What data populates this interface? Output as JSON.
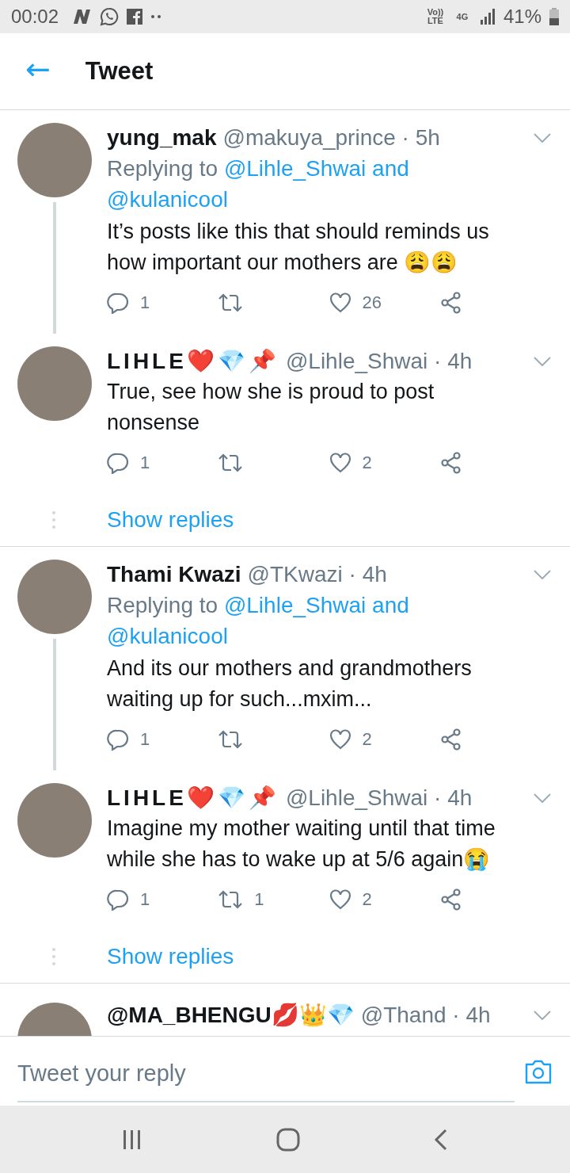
{
  "status_bar": {
    "time": "00:02",
    "network_label": "Vo)) LTE",
    "network_type": "4G",
    "battery": "41%"
  },
  "header": {
    "back": "←",
    "title": "Tweet"
  },
  "conversations": [
    {
      "tweets": [
        {
          "name": "yung_mak",
          "handle": "@makuya_prince · 5h",
          "replying_label": "Replying to",
          "replying_to": [
            "@Lihle_Shwai and",
            "@kulanicool"
          ],
          "text": "It’s posts like this that should reminds us how important our mothers are 😩😩",
          "replies": "1",
          "likes": "26",
          "thread_below": true,
          "spaced_name": false
        },
        {
          "name": "LIHLE❤️💎📌",
          "handle": "@Lihle_Shwai · 4h",
          "text": "True, see how she is proud to post nonsense",
          "replies": "1",
          "likes": "2",
          "thread_below": false,
          "spaced_name": true
        }
      ],
      "show_replies": "Show replies"
    },
    {
      "tweets": [
        {
          "name": "Thami Kwazi",
          "handle": "@TKwazi · 4h",
          "replying_label": "Replying to",
          "replying_to": [
            "@Lihle_Shwai and",
            "@kulanicool"
          ],
          "text": "And its our mothers and grandmothers waiting up for such...mxim...",
          "replies": "1",
          "likes": "2",
          "thread_below": true,
          "spaced_name": false
        },
        {
          "name": "LIHLE❤️💎📌",
          "handle": "@Lihle_Shwai · 4h",
          "text": "Imagine my mother waiting until that time while she has to wake up at 5/6 again😭",
          "replies": "1",
          "retweets": "1",
          "likes": "2",
          "thread_below": false,
          "spaced_name": true
        }
      ],
      "show_replies": "Show replies"
    },
    {
      "tweets": [
        {
          "name": "@MA_BHENGU💋👑💎",
          "handle": "@Thand · 4h",
          "thread_below": false,
          "spaced_name": false
        }
      ]
    }
  ],
  "reply_bar": {
    "placeholder": "Tweet your reply"
  }
}
